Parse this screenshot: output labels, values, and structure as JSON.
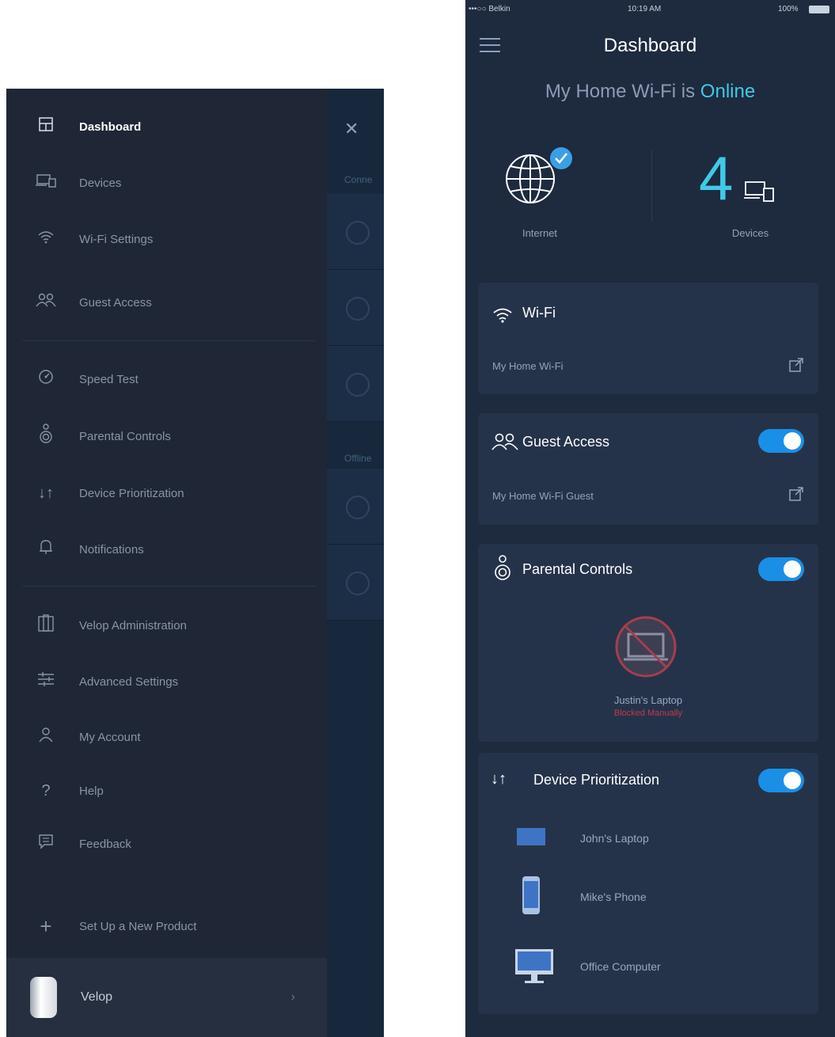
{
  "menu": {
    "items": [
      {
        "label": "Dashboard",
        "icon": "dashboard-icon"
      },
      {
        "label": "Devices",
        "icon": "devices-icon"
      },
      {
        "label": "Wi-Fi Settings",
        "icon": "wifi-icon"
      },
      {
        "label": "Guest Access",
        "icon": "guest-icon"
      },
      {
        "label": "Speed Test",
        "icon": "speedometer-icon"
      },
      {
        "label": "Parental Controls",
        "icon": "parental-icon"
      },
      {
        "label": "Device Prioritization",
        "icon": "priority-arrows-icon"
      },
      {
        "label": "Notifications",
        "icon": "bell-icon"
      },
      {
        "label": "Velop Administration",
        "icon": "velop-admin-icon"
      },
      {
        "label": "Advanced Settings",
        "icon": "sliders-icon"
      },
      {
        "label": "My Account",
        "icon": "user-icon"
      },
      {
        "label": "Help",
        "icon": "help-icon"
      },
      {
        "label": "Feedback",
        "icon": "feedback-icon"
      },
      {
        "label": "Set Up a New Product",
        "icon": "plus-icon"
      }
    ],
    "velop": {
      "label": "Velop",
      "chevron": "›"
    }
  },
  "background_screen": {
    "connected_label": "Conne",
    "offline_label": "Offline"
  },
  "status_bar": {
    "carrier": "•••○○ Belkin",
    "time": "10:19 AM",
    "battery": "100%"
  },
  "dashboard": {
    "title": "Dashboard",
    "headline_prefix": "My Home Wi-Fi is ",
    "headline_status": "Online",
    "internet_label": "Internet",
    "devices_count": "4",
    "devices_label": "Devices",
    "wifi": {
      "title": "Wi-Fi",
      "network": "My Home Wi-Fi"
    },
    "guest": {
      "title": "Guest Access",
      "network": "My Home Wi-Fi Guest",
      "enabled": true
    },
    "parental": {
      "title": "Parental Controls",
      "enabled": true,
      "device": "Justin's Laptop",
      "status": "Blocked Manually"
    },
    "prioritization": {
      "title": "Device Prioritization",
      "enabled": true,
      "devices": [
        {
          "label": "John's Laptop",
          "icon": "laptop-icon"
        },
        {
          "label": "Mike's Phone",
          "icon": "phone-icon"
        },
        {
          "label": "Office Computer",
          "icon": "desktop-icon"
        }
      ]
    }
  },
  "colors": {
    "accent": "#1a8fe6",
    "online": "#3fc9e8",
    "blocked": "#c0394b"
  }
}
